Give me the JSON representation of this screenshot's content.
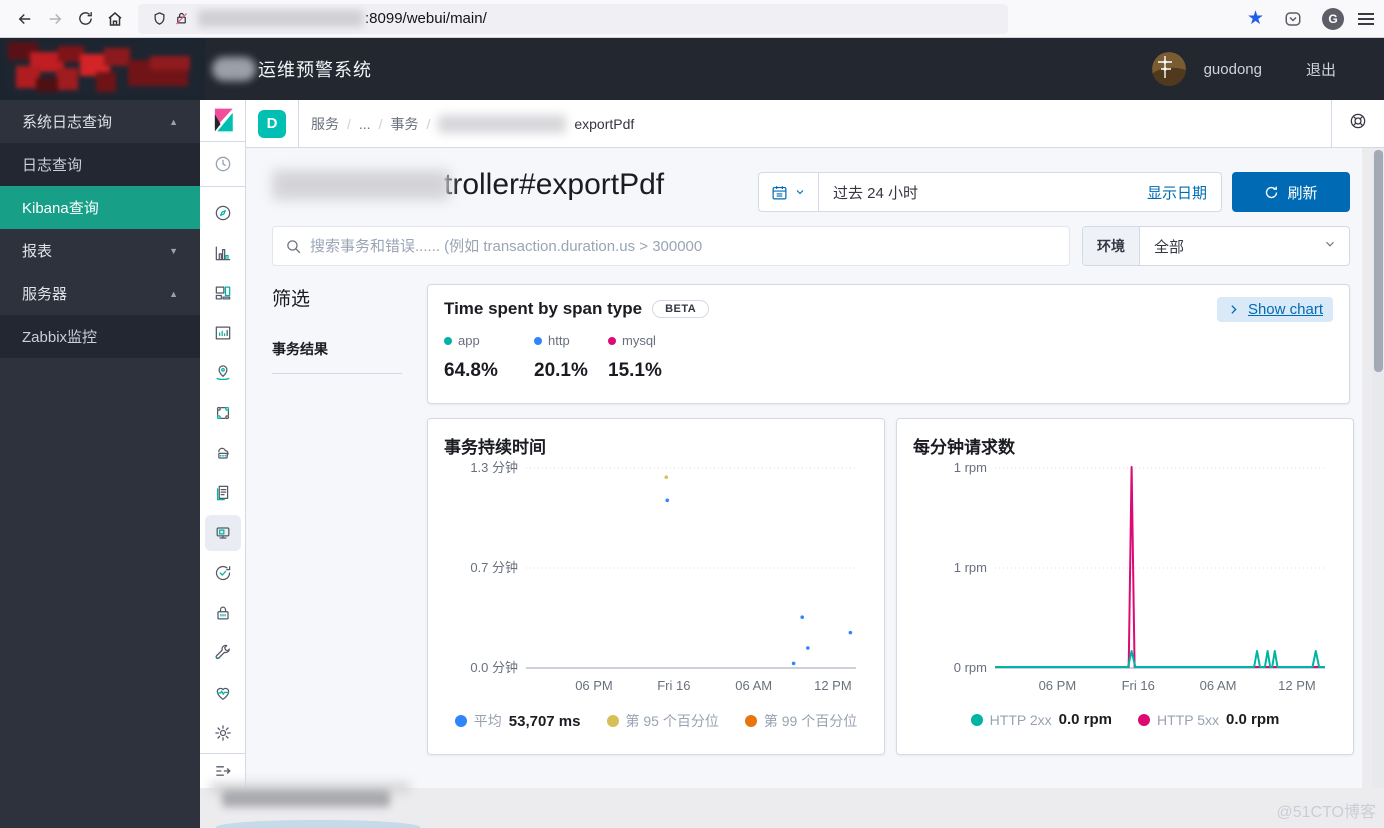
{
  "browser": {
    "url": ":8099/webui/main/"
  },
  "header": {
    "title": "运维预警系统",
    "user": "guodong",
    "logout": "退出"
  },
  "sidebar": {
    "items": [
      {
        "label": "系统日志查询",
        "style": "group",
        "arrow": "up"
      },
      {
        "label": "日志查询",
        "style": "sub"
      },
      {
        "label": "Kibana查询",
        "style": "active"
      },
      {
        "label": "报表",
        "style": "group",
        "arrow": "down"
      },
      {
        "label": "服务器",
        "style": "group",
        "arrow": "up"
      },
      {
        "label": "Zabbix监控",
        "style": "sub"
      }
    ]
  },
  "kibana_rail": {
    "icons": [
      {
        "name": "compass"
      },
      {
        "name": "bar-chart"
      },
      {
        "name": "dashboard"
      },
      {
        "name": "canvas"
      },
      {
        "name": "maps"
      },
      {
        "name": "machine-learning"
      },
      {
        "name": "infrastructure"
      },
      {
        "name": "logs"
      },
      {
        "name": "apm",
        "selected": true
      },
      {
        "name": "uptime"
      },
      {
        "name": "siem"
      },
      {
        "name": "dev-tools"
      },
      {
        "name": "monitoring"
      },
      {
        "name": "settings"
      }
    ]
  },
  "topbar": {
    "badge": "D",
    "breadcrumbs": [
      "服务",
      "...",
      "事务"
    ],
    "crumb_last": "exportPdf"
  },
  "page": {
    "title_visible": "troller#exportPdf",
    "timepicker": {
      "value": "过去 24 小时",
      "show_dates": "显示日期",
      "refresh": "刷新"
    },
    "search": {
      "placeholder": "搜索事务和错误...... (例如 transaction.duration.us > 300000"
    },
    "environment": {
      "label": "环境",
      "value": "全部"
    },
    "filters": {
      "title": "筛选",
      "section": "事务结果"
    },
    "span_panel": {
      "title": "Time spent by span type",
      "beta": "BETA",
      "show_chart": "Show chart",
      "legend": [
        {
          "label": "app",
          "color": "#00b3a4"
        },
        {
          "label": "http",
          "color": "#3185fc"
        },
        {
          "label": "mysql",
          "color": "#dd0a73"
        }
      ],
      "values": [
        "64.8%",
        "20.1%",
        "15.1%"
      ]
    }
  },
  "chart_data": [
    {
      "type": "scatter",
      "title": "事务持续时间",
      "ylabel": "分钟",
      "ymax": 1.3,
      "yticks": [
        {
          "label": "1.3 分钟",
          "frac": 1
        },
        {
          "label": "0.7 分钟",
          "frac": 0.5
        },
        {
          "label": "0.0 分钟",
          "frac": 0
        }
      ],
      "xticks": [
        {
          "label": "06 PM",
          "t": 0.206
        },
        {
          "label": "Fri 16",
          "t": 0.448
        },
        {
          "label": "06 AM",
          "t": 0.69
        },
        {
          "label": "12 PM",
          "t": 0.93
        }
      ],
      "series": [
        {
          "name": "第 95 个百分位",
          "color": "#d6bf57",
          "points": [
            {
              "t": 0.425,
              "v": 1.24
            }
          ]
        },
        {
          "name": "第 99 个百分位",
          "color": "#e8740c",
          "points": []
        },
        {
          "name": "平均",
          "color": "#3185fc",
          "points": [
            {
              "t": 0.428,
              "v": 1.09
            },
            {
              "t": 0.811,
              "v": 0.03
            },
            {
              "t": 0.837,
              "v": 0.33
            },
            {
              "t": 0.854,
              "v": 0.13
            },
            {
              "t": 0.983,
              "v": 0.23
            }
          ]
        }
      ],
      "legend": [
        {
          "label": "平均",
          "value": "53,707 ms",
          "color": "#3185fc"
        },
        {
          "label": "第 95 个百分位",
          "value": "",
          "color": "#d6bf57"
        },
        {
          "label": "第 99 个百分位",
          "value": "",
          "color": "#e8740c"
        }
      ]
    },
    {
      "type": "line",
      "title": "每分钟请求数",
      "ylabel": "rpm",
      "ymax": 1,
      "yticks": [
        {
          "label": "1 rpm",
          "frac": 1
        },
        {
          "label": "1 rpm",
          "frac": 0.5
        },
        {
          "label": "0 rpm",
          "frac": 0
        }
      ],
      "xticks": [
        {
          "label": "06 PM",
          "t": 0.189
        },
        {
          "label": "Fri 16",
          "t": 0.434
        },
        {
          "label": "06 AM",
          "t": 0.676
        },
        {
          "label": "12 PM",
          "t": 0.915
        }
      ],
      "series": [
        {
          "name": "HTTP 5xx",
          "color": "#dd0a73",
          "points": [
            {
              "t": 0,
              "v": 0
            },
            {
              "t": 0.405,
              "v": 0
            },
            {
              "t": 0.414,
              "v": 1
            },
            {
              "t": 0.423,
              "v": 0
            },
            {
              "t": 1,
              "v": 0
            }
          ]
        },
        {
          "name": "HTTP 2xx",
          "color": "#00b3a4",
          "points": [
            {
              "t": 0,
              "v": 0
            },
            {
              "t": 0.403,
              "v": 0
            },
            {
              "t": 0.414,
              "v": 0.08
            },
            {
              "t": 0.425,
              "v": 0
            },
            {
              "t": 0.785,
              "v": 0
            },
            {
              "t": 0.794,
              "v": 0.08
            },
            {
              "t": 0.803,
              "v": 0
            },
            {
              "t": 0.818,
              "v": 0
            },
            {
              "t": 0.826,
              "v": 0.08
            },
            {
              "t": 0.834,
              "v": 0
            },
            {
              "t": 0.84,
              "v": 0
            },
            {
              "t": 0.848,
              "v": 0.08
            },
            {
              "t": 0.856,
              "v": 0
            },
            {
              "t": 0.962,
              "v": 0
            },
            {
              "t": 0.972,
              "v": 0.08
            },
            {
              "t": 0.982,
              "v": 0
            },
            {
              "t": 1,
              "v": 0
            }
          ]
        }
      ],
      "legend": [
        {
          "label": "HTTP 2xx",
          "value": "0.0 rpm",
          "color": "#00b3a4"
        },
        {
          "label": "HTTP 5xx",
          "value": "0.0 rpm",
          "color": "#dd0a73"
        }
      ]
    }
  ],
  "footer": {
    "watermark": "@51CTO博客"
  }
}
